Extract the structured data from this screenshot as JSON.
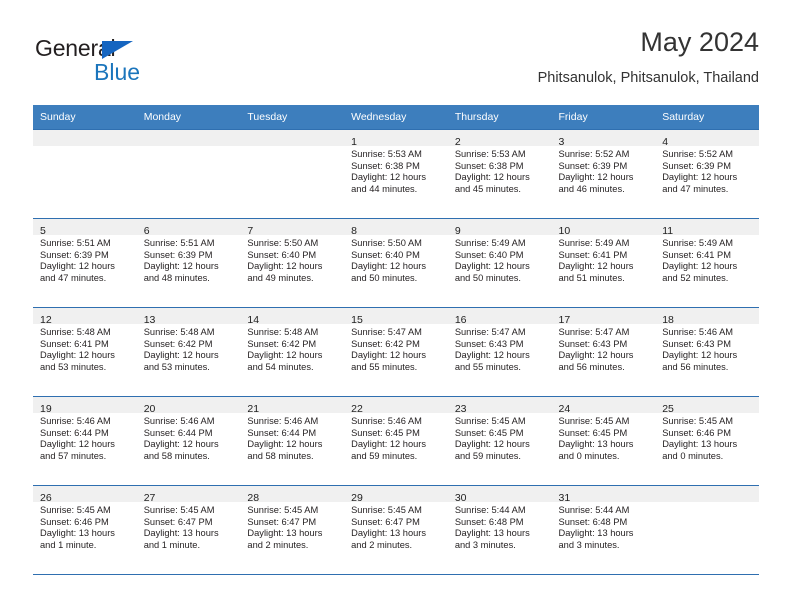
{
  "brand": {
    "name_top": "General",
    "name_bottom": "Blue",
    "accent_color": "#1b75bc",
    "triangle_color": "#1565c0"
  },
  "header": {
    "title": "May 2024",
    "subtitle": "Phitsanulok, Phitsanulok, Thailand"
  },
  "calendar": {
    "header_bg": "#3d7ebd",
    "header_text_color": "#ffffff",
    "row_border_color": "#2f6fb0",
    "date_band_bg": "#f0f0f0",
    "weekdays": [
      "Sunday",
      "Monday",
      "Tuesday",
      "Wednesday",
      "Thursday",
      "Friday",
      "Saturday"
    ],
    "weeks": [
      [
        {
          "day": "",
          "lines": []
        },
        {
          "day": "",
          "lines": []
        },
        {
          "day": "",
          "lines": []
        },
        {
          "day": "1",
          "lines": [
            "Sunrise: 5:53 AM",
            "Sunset: 6:38 PM",
            "Daylight: 12 hours",
            "and 44 minutes."
          ]
        },
        {
          "day": "2",
          "lines": [
            "Sunrise: 5:53 AM",
            "Sunset: 6:38 PM",
            "Daylight: 12 hours",
            "and 45 minutes."
          ]
        },
        {
          "day": "3",
          "lines": [
            "Sunrise: 5:52 AM",
            "Sunset: 6:39 PM",
            "Daylight: 12 hours",
            "and 46 minutes."
          ]
        },
        {
          "day": "4",
          "lines": [
            "Sunrise: 5:52 AM",
            "Sunset: 6:39 PM",
            "Daylight: 12 hours",
            "and 47 minutes."
          ]
        }
      ],
      [
        {
          "day": "5",
          "lines": [
            "Sunrise: 5:51 AM",
            "Sunset: 6:39 PM",
            "Daylight: 12 hours",
            "and 47 minutes."
          ]
        },
        {
          "day": "6",
          "lines": [
            "Sunrise: 5:51 AM",
            "Sunset: 6:39 PM",
            "Daylight: 12 hours",
            "and 48 minutes."
          ]
        },
        {
          "day": "7",
          "lines": [
            "Sunrise: 5:50 AM",
            "Sunset: 6:40 PM",
            "Daylight: 12 hours",
            "and 49 minutes."
          ]
        },
        {
          "day": "8",
          "lines": [
            "Sunrise: 5:50 AM",
            "Sunset: 6:40 PM",
            "Daylight: 12 hours",
            "and 50 minutes."
          ]
        },
        {
          "day": "9",
          "lines": [
            "Sunrise: 5:49 AM",
            "Sunset: 6:40 PM",
            "Daylight: 12 hours",
            "and 50 minutes."
          ]
        },
        {
          "day": "10",
          "lines": [
            "Sunrise: 5:49 AM",
            "Sunset: 6:41 PM",
            "Daylight: 12 hours",
            "and 51 minutes."
          ]
        },
        {
          "day": "11",
          "lines": [
            "Sunrise: 5:49 AM",
            "Sunset: 6:41 PM",
            "Daylight: 12 hours",
            "and 52 minutes."
          ]
        }
      ],
      [
        {
          "day": "12",
          "lines": [
            "Sunrise: 5:48 AM",
            "Sunset: 6:41 PM",
            "Daylight: 12 hours",
            "and 53 minutes."
          ]
        },
        {
          "day": "13",
          "lines": [
            "Sunrise: 5:48 AM",
            "Sunset: 6:42 PM",
            "Daylight: 12 hours",
            "and 53 minutes."
          ]
        },
        {
          "day": "14",
          "lines": [
            "Sunrise: 5:48 AM",
            "Sunset: 6:42 PM",
            "Daylight: 12 hours",
            "and 54 minutes."
          ]
        },
        {
          "day": "15",
          "lines": [
            "Sunrise: 5:47 AM",
            "Sunset: 6:42 PM",
            "Daylight: 12 hours",
            "and 55 minutes."
          ]
        },
        {
          "day": "16",
          "lines": [
            "Sunrise: 5:47 AM",
            "Sunset: 6:43 PM",
            "Daylight: 12 hours",
            "and 55 minutes."
          ]
        },
        {
          "day": "17",
          "lines": [
            "Sunrise: 5:47 AM",
            "Sunset: 6:43 PM",
            "Daylight: 12 hours",
            "and 56 minutes."
          ]
        },
        {
          "day": "18",
          "lines": [
            "Sunrise: 5:46 AM",
            "Sunset: 6:43 PM",
            "Daylight: 12 hours",
            "and 56 minutes."
          ]
        }
      ],
      [
        {
          "day": "19",
          "lines": [
            "Sunrise: 5:46 AM",
            "Sunset: 6:44 PM",
            "Daylight: 12 hours",
            "and 57 minutes."
          ]
        },
        {
          "day": "20",
          "lines": [
            "Sunrise: 5:46 AM",
            "Sunset: 6:44 PM",
            "Daylight: 12 hours",
            "and 58 minutes."
          ]
        },
        {
          "day": "21",
          "lines": [
            "Sunrise: 5:46 AM",
            "Sunset: 6:44 PM",
            "Daylight: 12 hours",
            "and 58 minutes."
          ]
        },
        {
          "day": "22",
          "lines": [
            "Sunrise: 5:46 AM",
            "Sunset: 6:45 PM",
            "Daylight: 12 hours",
            "and 59 minutes."
          ]
        },
        {
          "day": "23",
          "lines": [
            "Sunrise: 5:45 AM",
            "Sunset: 6:45 PM",
            "Daylight: 12 hours",
            "and 59 minutes."
          ]
        },
        {
          "day": "24",
          "lines": [
            "Sunrise: 5:45 AM",
            "Sunset: 6:45 PM",
            "Daylight: 13 hours",
            "and 0 minutes."
          ]
        },
        {
          "day": "25",
          "lines": [
            "Sunrise: 5:45 AM",
            "Sunset: 6:46 PM",
            "Daylight: 13 hours",
            "and 0 minutes."
          ]
        }
      ],
      [
        {
          "day": "26",
          "lines": [
            "Sunrise: 5:45 AM",
            "Sunset: 6:46 PM",
            "Daylight: 13 hours",
            "and 1 minute."
          ]
        },
        {
          "day": "27",
          "lines": [
            "Sunrise: 5:45 AM",
            "Sunset: 6:47 PM",
            "Daylight: 13 hours",
            "and 1 minute."
          ]
        },
        {
          "day": "28",
          "lines": [
            "Sunrise: 5:45 AM",
            "Sunset: 6:47 PM",
            "Daylight: 13 hours",
            "and 2 minutes."
          ]
        },
        {
          "day": "29",
          "lines": [
            "Sunrise: 5:45 AM",
            "Sunset: 6:47 PM",
            "Daylight: 13 hours",
            "and 2 minutes."
          ]
        },
        {
          "day": "30",
          "lines": [
            "Sunrise: 5:44 AM",
            "Sunset: 6:48 PM",
            "Daylight: 13 hours",
            "and 3 minutes."
          ]
        },
        {
          "day": "31",
          "lines": [
            "Sunrise: 5:44 AM",
            "Sunset: 6:48 PM",
            "Daylight: 13 hours",
            "and 3 minutes."
          ]
        },
        {
          "day": "",
          "lines": []
        }
      ]
    ]
  }
}
